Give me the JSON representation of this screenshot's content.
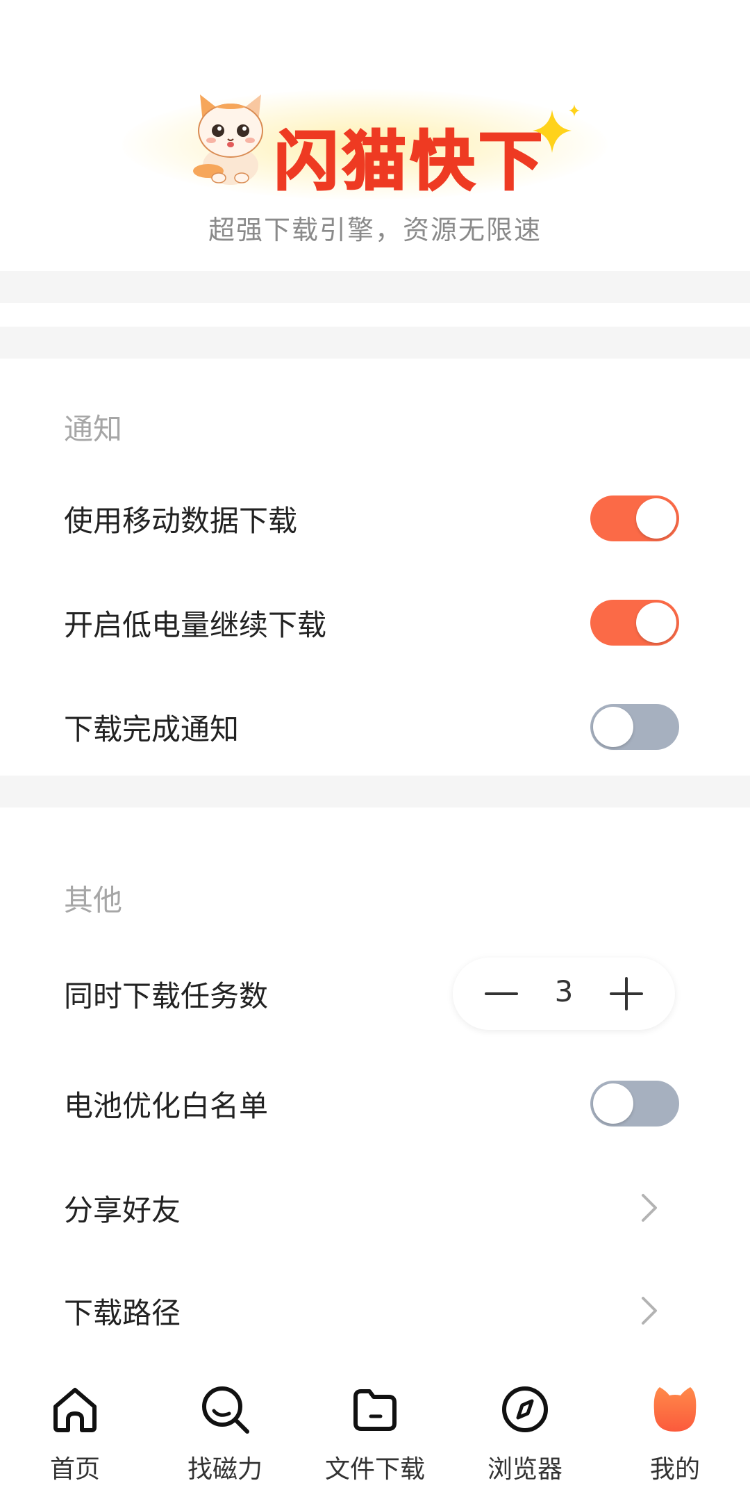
{
  "brand": {
    "name": "闪猫快下",
    "slogan": "超强下载引擎，资源无限速"
  },
  "colors": {
    "accent": "#fb6a47",
    "brand_red": "#ee3a22",
    "toggle_off": "#a6b0bf",
    "section_title": "#a6a6a6"
  },
  "notifications": {
    "title": "通知",
    "items": [
      {
        "label": "使用移动数据下载",
        "state": "on"
      },
      {
        "label": "开启低电量继续下载",
        "state": "on"
      },
      {
        "label": "下载完成通知",
        "state": "off"
      }
    ]
  },
  "other": {
    "title": "其他",
    "concurrent_tasks": {
      "label": "同时下载任务数",
      "value": "3"
    },
    "battery_whitelist": {
      "label": "电池优化白名单",
      "state": "off"
    },
    "share": {
      "label": "分享好友"
    },
    "download_path": {
      "label": "下载路径"
    }
  },
  "tabbar": {
    "tabs": [
      {
        "label": "首页",
        "icon": "home-icon"
      },
      {
        "label": "找磁力",
        "icon": "search-icon"
      },
      {
        "label": "文件下载",
        "icon": "folder-icon"
      },
      {
        "label": "浏览器",
        "icon": "compass-icon"
      },
      {
        "label": "我的",
        "icon": "cat-avatar-icon",
        "active": true
      }
    ]
  }
}
